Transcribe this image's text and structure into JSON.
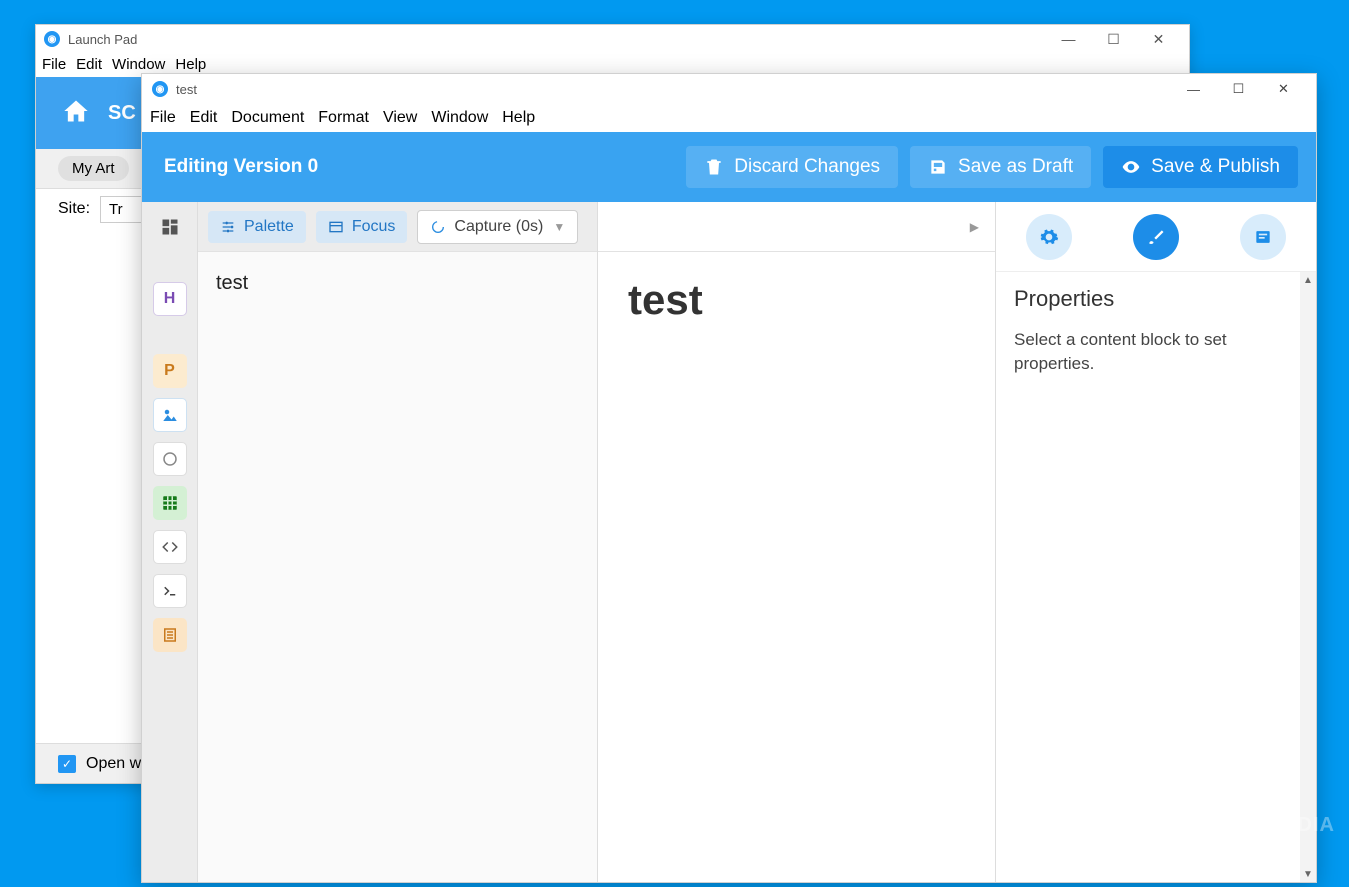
{
  "bg_window": {
    "title": "Launch Pad",
    "menubar": [
      "File",
      "Edit",
      "Window",
      "Help"
    ],
    "blue_label": "SC",
    "toolbar_pill": "My Art",
    "site_label": "Site:",
    "site_value": "Tr",
    "open_check_label": "Open w"
  },
  "fg_window": {
    "title": "test",
    "menubar": [
      "File",
      "Edit",
      "Document",
      "Format",
      "View",
      "Window",
      "Help"
    ],
    "actionbar": {
      "editing_label": "Editing Version 0",
      "discard": "Discard Changes",
      "save_draft": "Save as Draft",
      "save_publish": "Save & Publish"
    },
    "left_toolbar": {
      "palette": "Palette",
      "focus": "Focus",
      "capture": "Capture (0s)"
    },
    "left_content": "test",
    "center_heading": "test",
    "right": {
      "heading": "Properties",
      "help_text": "Select a content block to set properties."
    },
    "rail_tools": {
      "h": "H",
      "p": "P"
    }
  },
  "watermark": "SOFTPEDIA"
}
